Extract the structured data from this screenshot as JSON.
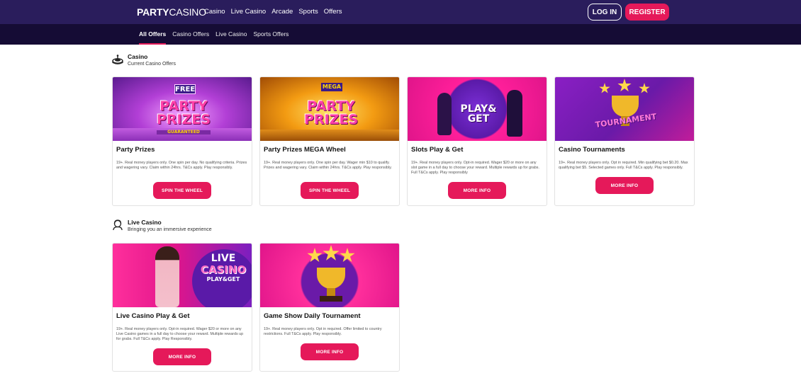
{
  "header": {
    "logo_bold": "PARTY",
    "logo_thin": "CASINO",
    "nav": [
      "Casino",
      "Live Casino",
      "Arcade",
      "Sports",
      "Offers"
    ],
    "login": "LOG IN",
    "register": "REGISTER"
  },
  "subnav": {
    "items": [
      "All Offers",
      "Casino Offers",
      "Live Casino",
      "Sports Offers"
    ]
  },
  "sections": {
    "casino": {
      "title": "Casino",
      "subtitle": "Current Casino Offers",
      "icon": "roulette-icon"
    },
    "live": {
      "title": "Live Casino",
      "subtitle": "Bringing you an immersive experience",
      "icon": "dealer-icon"
    }
  },
  "cards": [
    {
      "title": "Party Prizes",
      "desc": "19+. Real money players only. One spin per day. No qualifying criteria. Prizes and wagering vary. Claim within 24hrs. T&Cs apply. Play responsibly.",
      "cta": "SPIN THE WHEEL",
      "banner_top": "FREE",
      "banner_main": "PARTY PRIZES",
      "banner_sub": "GUARANTEED"
    },
    {
      "title": "Party Prizes MEGA Wheel",
      "desc": "19+. Real money players only. One spin per day. Wager min $10 to qualify. Prizes and wagering vary. Claim within 24hrs. T&Cs apply. Play responsibly.",
      "cta": "SPIN THE WHEEL",
      "banner_top": "MEGA",
      "banner_main": "PARTY PRIZES"
    },
    {
      "title": "Slots Play & Get",
      "desc": "19+. Real money players only. Opt-in required. Wager $20 or more on any slot game in a full day to choose your reward. Multiple rewards up for grabs. Full T&Cs apply. Play responsibly",
      "cta": "MORE INFO",
      "banner_main": "PLAY& GET"
    },
    {
      "title": "Casino Tournaments",
      "desc": "19+. Real money players only. Opt in required. Min qualifying bet $0.20. Max qualifying bet $5. Selected games only. Full T&Cs apply. Play responsibly.",
      "cta": "MORE INFO",
      "banner_main": "TOURNAMENT"
    },
    {
      "title": "Live Casino Play & Get",
      "desc": "19+. Real money players only. Opt-in required. Wager $20 or more on any Live Casino games in a full day to choose your reward. Multiple rewards up for grabs. Full T&Cs apply. Play Responsibly.",
      "cta": "MORE INFO",
      "banner_top": "LIVE",
      "banner_main": "CASINO",
      "banner_sub": "PLAY&GET"
    },
    {
      "title": "Game Show Daily Tournament",
      "desc": "19+. Real money players only. Opt in required. Offer limited to country restrictions. Full T&Cs apply. Play responsibly.",
      "cta": "MORE INFO"
    }
  ],
  "colors": {
    "nav_bg": "#2a1d5c",
    "subnav_bg": "#150c35",
    "accent": "#e5195a"
  }
}
